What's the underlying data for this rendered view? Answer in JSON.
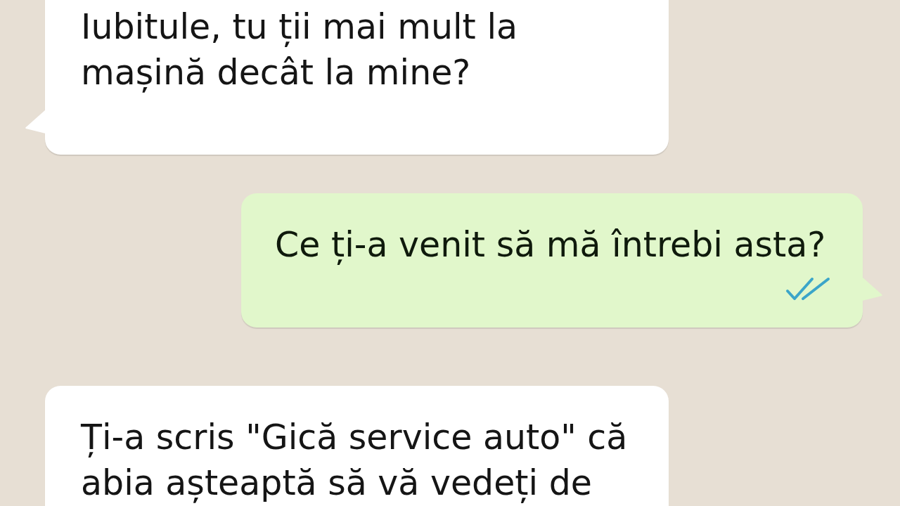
{
  "chat": {
    "messages": [
      {
        "kind": "incoming",
        "text": "Iubitule, tu ții mai mult la\nmașină decât la mine?"
      },
      {
        "kind": "outgoing",
        "text": "Ce ți-a venit să mă întrebi asta?",
        "read": true
      },
      {
        "kind": "incoming",
        "text": "Ți-a scris \"Gică service auto\" că\nabia așteaptă să vă vedeți de"
      }
    ]
  }
}
